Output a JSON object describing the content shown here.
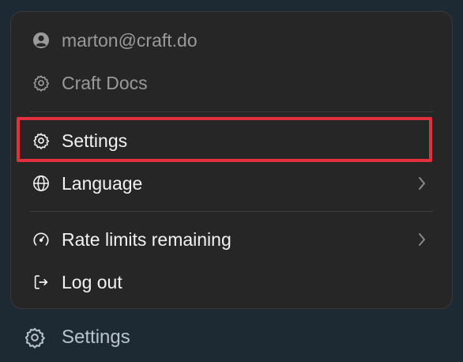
{
  "menu": {
    "account": {
      "label": "marton@craft.do",
      "icon": "person-circle-icon"
    },
    "workspace": {
      "label": "Craft Docs",
      "icon": "gear-icon"
    },
    "settings": {
      "label": "Settings",
      "icon": "gear-icon"
    },
    "language": {
      "label": "Language",
      "icon": "globe-icon"
    },
    "rate_limits": {
      "label": "Rate limits remaining",
      "icon": "speedometer-icon"
    },
    "logout": {
      "label": "Log out",
      "icon": "logout-icon"
    }
  },
  "sidebar": {
    "settings": {
      "label": "Settings",
      "icon": "gear-icon"
    }
  },
  "colors": {
    "highlight": "#e3303f",
    "menu_bg": "#262626",
    "page_bg": "#1d2a34"
  }
}
